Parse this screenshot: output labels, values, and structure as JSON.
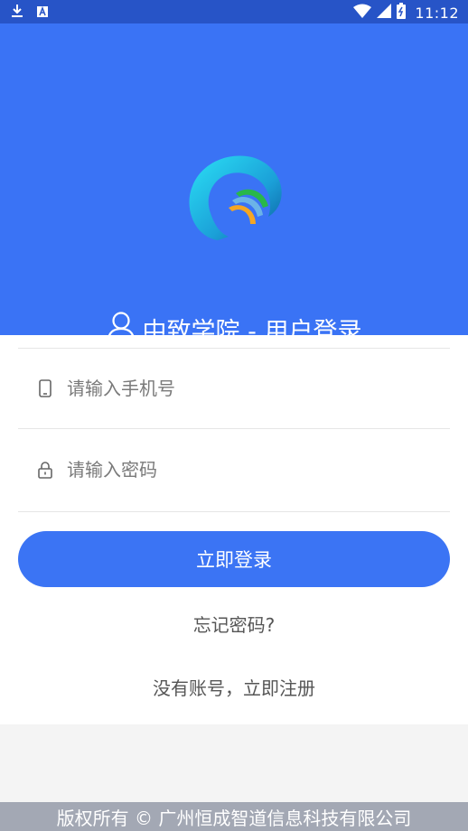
{
  "status_bar": {
    "time": "11:12",
    "icons": [
      "download-icon",
      "app-notification-icon",
      "wifi-icon",
      "signal-icon",
      "battery-icon"
    ]
  },
  "header": {
    "title": "中致学院 - 用户登录",
    "background_color": "#3a73f5"
  },
  "form": {
    "phone_placeholder": "请输入手机号",
    "password_placeholder": "请输入密码",
    "login_label": "立即登录",
    "forgot_label": "忘记密码?",
    "register_label": "没有账号，立即注册"
  },
  "footer": {
    "text": "版权所有 © 广州恒成智道信息科技有限公司"
  },
  "colors": {
    "accent": "#3b74f4",
    "status_bar": "#2754c7",
    "footer_bg": "#a3a8b4"
  }
}
